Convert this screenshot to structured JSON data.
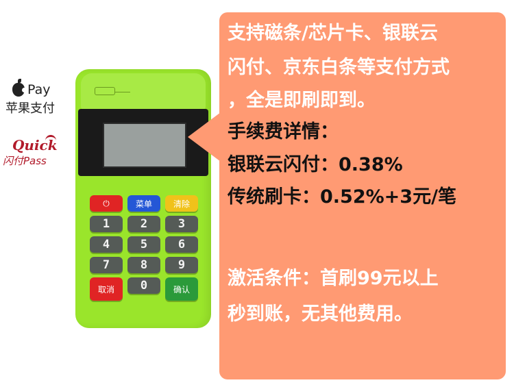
{
  "logos": {
    "apple_pay_text": "Pay",
    "apple_pay_cn": "苹果支付",
    "quickpass_top": "Quick",
    "quickpass_bottom": "闪付Pass"
  },
  "keypad": {
    "power": "⏻",
    "menu": "菜单",
    "clear": "清除",
    "k1": "1",
    "k2": "2",
    "k3": "3",
    "k4": "4",
    "k5": "5",
    "k6": "6",
    "k7": "7",
    "k8": "8",
    "k9": "9",
    "k0": "0",
    "cancel": "取消",
    "confirm": "确认"
  },
  "callout": {
    "line1": "支持磁条/芯片卡、银联云",
    "line2": "闪付、京东白条等支付方式",
    "line3": "，全是即刷即到。",
    "line4": "手续费详情：",
    "line5": "银联云闪付：0.38%",
    "line6": "传统刷卡：0.52%+3元/笔",
    "line7": "激活条件：首刷99元以上",
    "line8": "秒到账，无其他费用。"
  },
  "colors": {
    "callout_bg": "#ff9a73",
    "device_green": "#9ae52b"
  }
}
